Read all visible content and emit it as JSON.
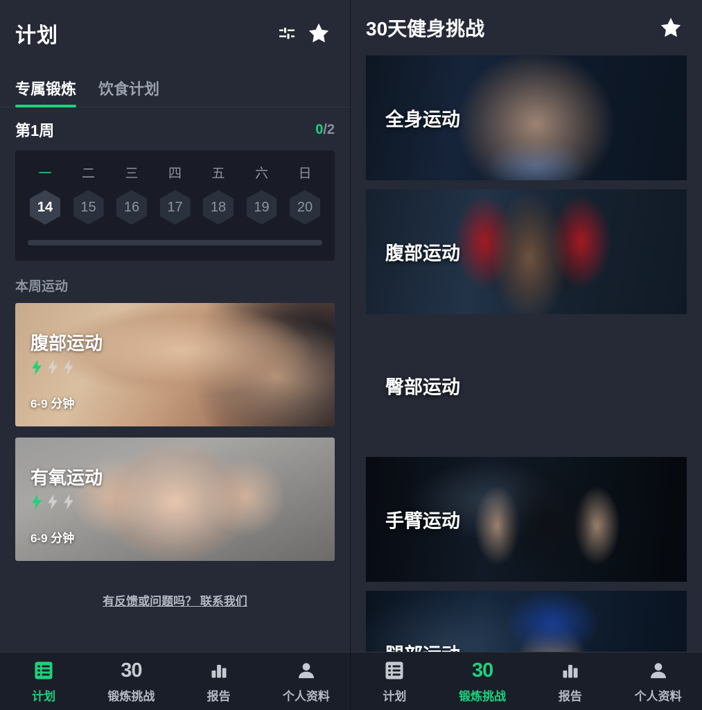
{
  "left": {
    "header": {
      "title": "计划",
      "filter_icon": "sliders-icon",
      "star_icon": "star-icon"
    },
    "tabs": [
      {
        "label": "专属锻炼",
        "active": true
      },
      {
        "label": "饮食计划",
        "active": false
      }
    ],
    "week": {
      "label": "第1周",
      "completed": "0",
      "total": "/2"
    },
    "calendar": {
      "day_names": [
        "一",
        "二",
        "三",
        "四",
        "五",
        "六",
        "日"
      ],
      "dates": [
        "14",
        "15",
        "16",
        "17",
        "18",
        "19",
        "20"
      ],
      "selected_index": 0,
      "today_index": 0,
      "progress_percent": 0
    },
    "section_title": "本周运动",
    "workouts": [
      {
        "title": "腹部运动",
        "duration": "6-9 分钟",
        "difficulty": 1,
        "difficulty_max": 3,
        "image": "abs-workout-photo"
      },
      {
        "title": "有氧运动",
        "duration": "6-9 分钟",
        "difficulty": 1,
        "difficulty_max": 3,
        "image": "cardio-workout-photo"
      }
    ],
    "feedback": "有反馈或问题吗？ 联系我们",
    "nav": [
      {
        "label": "计划",
        "icon": "list-icon",
        "active": true
      },
      {
        "label": "锻炼挑战",
        "icon": "30-icon",
        "active": false
      },
      {
        "label": "报告",
        "icon": "bar-chart-icon",
        "active": false
      },
      {
        "label": "个人资料",
        "icon": "person-icon",
        "active": false
      }
    ]
  },
  "right": {
    "header": {
      "title": "30天健身挑战",
      "star_icon": "star-icon"
    },
    "challenges": [
      {
        "title": "全身运动",
        "image": "full-body-photo"
      },
      {
        "title": "腹部运动",
        "image": "abs-photo"
      },
      {
        "title": "臀部运动",
        "image": "hip-photo"
      },
      {
        "title": "手臂运动",
        "image": "arm-photo"
      },
      {
        "title": "腿部运动",
        "image": "leg-photo"
      }
    ],
    "nav": [
      {
        "label": "计划",
        "icon": "list-icon",
        "active": false
      },
      {
        "label": "锻炼挑战",
        "icon": "30-icon",
        "active": true
      },
      {
        "label": "报告",
        "icon": "bar-chart-icon",
        "active": false
      },
      {
        "label": "个人资料",
        "icon": "person-icon",
        "active": false
      }
    ]
  },
  "colors": {
    "accent": "#1fd17c",
    "background": "#252a36",
    "card": "#191c26",
    "navbar": "#1a1e28"
  }
}
